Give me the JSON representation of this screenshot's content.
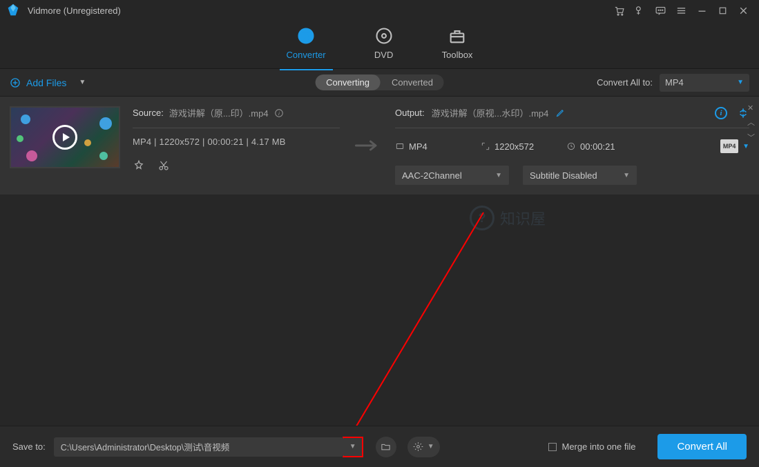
{
  "titlebar": {
    "app_name": "Vidmore (Unregistered)"
  },
  "tabs": {
    "converter": "Converter",
    "dvd": "DVD",
    "toolbox": "Toolbox"
  },
  "subbar": {
    "add_files": "Add Files",
    "pill_converting": "Converting",
    "pill_converted": "Converted",
    "convert_all_to_label": "Convert All to:",
    "convert_all_to_value": "MP4"
  },
  "item": {
    "source_label": "Source:",
    "source_file": "游戏讲解（原...印）.mp4",
    "source_meta": "MP4 | 1220x572 | 00:00:21 | 4.17 MB",
    "output_label": "Output:",
    "output_file": "游戏讲解（原视...水印）.mp4",
    "out_format": "MP4",
    "out_res": "1220x572",
    "out_dur": "00:00:21",
    "fmt_box": "MP4",
    "audio_select": "AAC-2Channel",
    "subtitle_select": "Subtitle Disabled"
  },
  "bottom": {
    "saveto_label": "Save to:",
    "path": "C:\\Users\\Administrator\\Desktop\\测试\\音视频",
    "merge_label": "Merge into one file",
    "convert_all": "Convert All"
  },
  "watermark": "知识屋"
}
